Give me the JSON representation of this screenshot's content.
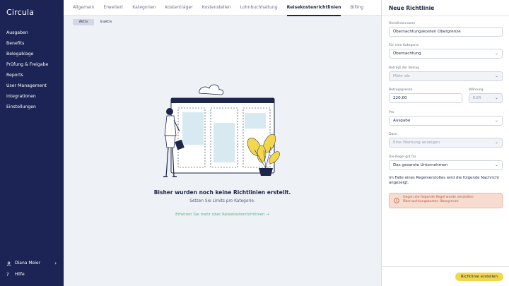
{
  "brand": {
    "name": "Circula"
  },
  "sidebar": {
    "items": [
      {
        "label": "Ausgaben"
      },
      {
        "label": "Benefits"
      },
      {
        "label": "Belegablage"
      },
      {
        "label": "Prüfung & Freigabe"
      },
      {
        "label": "Reports"
      },
      {
        "label": "User Management"
      },
      {
        "label": "Integrationen"
      },
      {
        "label": "Einstellungen"
      }
    ],
    "user": {
      "name": "Diana Meier"
    },
    "help": {
      "label": "Hilfe"
    }
  },
  "tabs": [
    {
      "label": "Allgemein"
    },
    {
      "label": "Erweitert"
    },
    {
      "label": "Kategorien"
    },
    {
      "label": "Kostenträger"
    },
    {
      "label": "Kostenstellen"
    },
    {
      "label": "Lohnbuchhaltung"
    },
    {
      "label": "Reisekostenrichtlinien",
      "active": true
    },
    {
      "label": "Billing"
    }
  ],
  "segment": {
    "active": "Aktiv",
    "inactive": "Inaktiv"
  },
  "empty_state": {
    "title": "Bisher wurden noch keine Richtlinien erstellt.",
    "subtitle": "Setzen Sie Limits pro Kategorie.",
    "link": "Erfahren Sie mehr über Reisekostenrichtlinien →"
  },
  "panel": {
    "title": "Neue Richtlinie",
    "name_label": "Richtlinienname",
    "name_value": "Übernachtungskosten Obergrenze",
    "category_label": "Für eine Kategorie",
    "category_value": "Übernachtung",
    "amount_cond_label": "Beträgt der Betrag",
    "amount_cond_value": "Mehr als",
    "limit_label": "Betragsgrenze",
    "limit_value": "220,00",
    "currency_label": "Währung",
    "currency_value": "EUR",
    "per_label": "Pro",
    "per_value": "Ausgabe",
    "then_label": "Dann",
    "then_value": "Eine Warnung anzeigen",
    "applies_label": "Die Regel gilt für",
    "applies_value": "Das gesamte Unternehmen",
    "note": "Im Falle eines Regelverstoßes wird die folgende Nachricht angezeigt.",
    "alert_text": "Gegen die folgende Regel wurde verstoßen: Übernachtungskosten Obergrenze",
    "create_button": "Richtlinie erstellen"
  },
  "colors": {
    "sidebar": "#1b2454",
    "accent_button": "#f2d74e",
    "link_green": "#58b189",
    "alert_bg": "#f8dcd0"
  }
}
